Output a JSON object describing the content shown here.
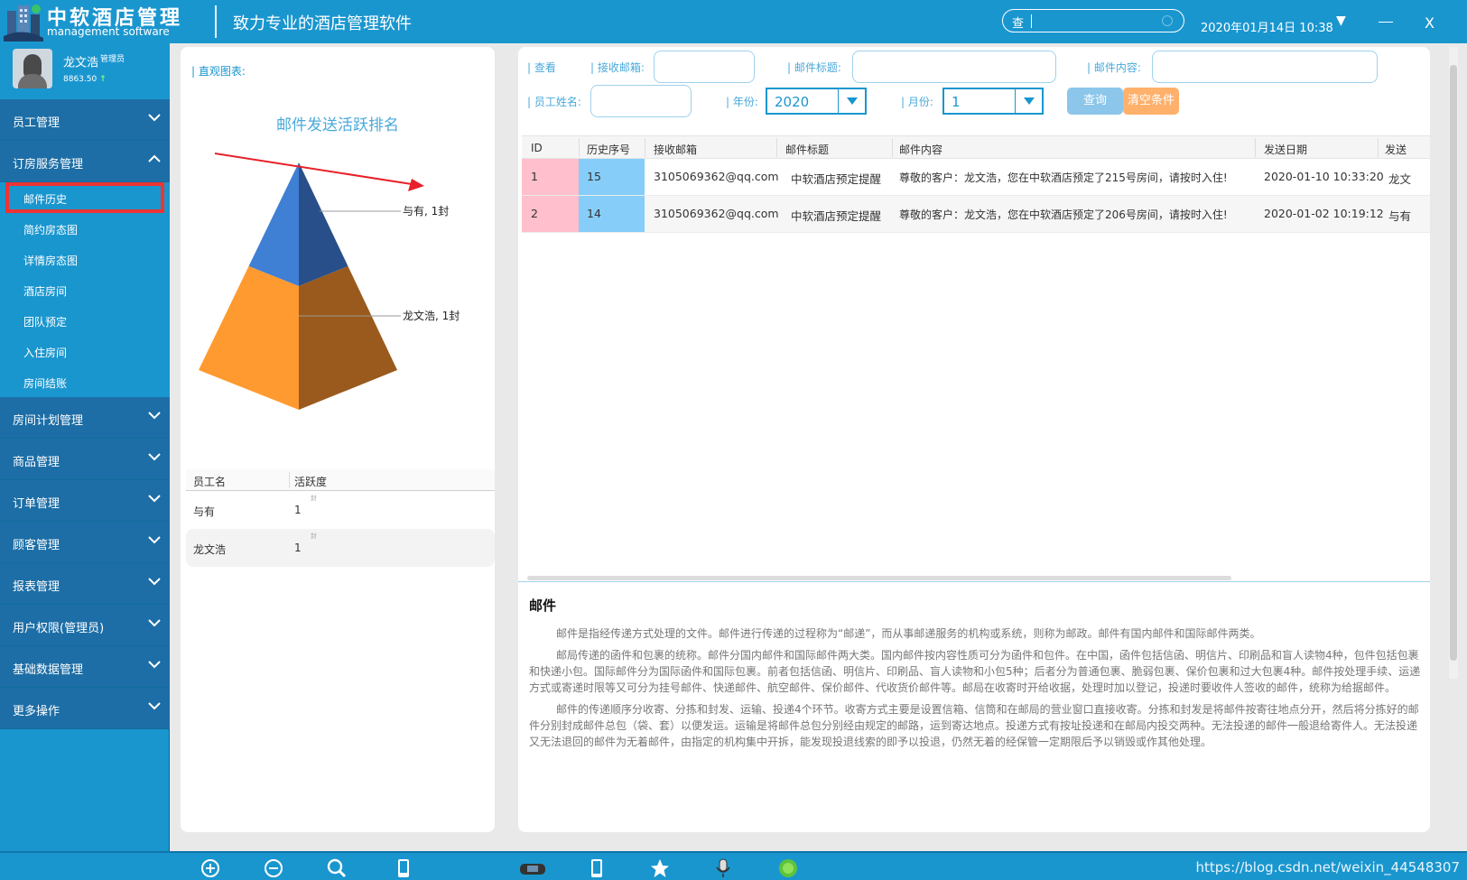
{
  "topbar": {
    "title": "中软酒店管理",
    "subtitle": "management software",
    "slogan": "致力专业的酒店管理软件",
    "search_label": "查",
    "datetime": "2020年01月14日 10:38",
    "dropdown_glyph": "▼",
    "close_label": "X"
  },
  "user": {
    "name": "龙文浩",
    "role": "管理员",
    "balance": "8863.50",
    "trend": "↑"
  },
  "menu": {
    "groups": [
      {
        "label": "员工管理"
      },
      {
        "label": "订房服务管理"
      },
      {
        "label": "房间计划管理"
      },
      {
        "label": "商品管理"
      },
      {
        "label": "订单管理"
      },
      {
        "label": "顾客管理"
      },
      {
        "label": "报表管理"
      },
      {
        "label": "用户权限(管理员)"
      },
      {
        "label": "基础数据管理"
      },
      {
        "label": "更多操作"
      }
    ],
    "sub_items": [
      "邮件历史",
      "简约房态图",
      "详情房态图",
      "酒店房间",
      "团队预定",
      "入住房间",
      "房间结账"
    ]
  },
  "chart_panel": {
    "tag": "| 直观图表:",
    "title": "邮件发送活跃排名"
  },
  "chart_data": {
    "type": "pyramid",
    "title": "邮件发送活跃排名",
    "categories": [
      "与有",
      "龙文浩"
    ],
    "values": [
      1,
      1
    ],
    "data_labels": [
      "与有, 1封",
      "龙文浩, 1封"
    ],
    "colors": {
      "top": "#3f7fd4",
      "top_dark": "#294f8a",
      "bottom": "#ff9a30",
      "bottom_dark": "#9a5a1d"
    }
  },
  "mini_table": {
    "headers": [
      "员工名",
      "活跃度"
    ],
    "unit": "封",
    "rows": [
      {
        "name": "与有",
        "value": "1"
      },
      {
        "name": "龙文浩",
        "value": "1"
      }
    ]
  },
  "filters": {
    "view_label": "| 查看",
    "recv_label": "| 接收邮箱:",
    "subject_label": "| 邮件标题:",
    "content_label": "| 邮件内容:",
    "employee_label": "| 员工姓名:",
    "year_label": "| 年份:",
    "year_value": "2020",
    "month_label": "| 月份:",
    "month_value": "1",
    "query_button": "查询",
    "clear_button": "清空条件"
  },
  "grid": {
    "headers": [
      "ID",
      "历史序号",
      "接收邮箱",
      "邮件标题",
      "邮件内容",
      "发送日期",
      "发送"
    ],
    "rows": [
      {
        "id": "1",
        "hist": "15",
        "email": "3105069362@qq.com",
        "subject": "中软酒店预定提醒",
        "content": "尊敬的客户：龙文浩，您在中软酒店预定了215号房间，请按时入住!",
        "date": "2020-01-10 10:33:20",
        "sender": "龙文"
      },
      {
        "id": "2",
        "hist": "14",
        "email": "3105069362@qq.com",
        "subject": "中软酒店预定提醒",
        "content": "尊敬的客户：龙文浩，您在中软酒店预定了206号房间，请按时入住!",
        "date": "2020-01-02 10:19:12",
        "sender": "与有"
      }
    ]
  },
  "doc": {
    "heading": "邮件",
    "paragraphs": [
      "邮件是指经传递方式处理的文件。邮件进行传递的过程称为“邮递”，而从事邮递服务的机构或系统，则称为邮政。邮件有国内邮件和国际邮件两类。",
      "邮局传递的函件和包裹的统称。邮件分国内邮件和国际邮件两大类。国内邮件按内容性质可分为函件和包件。在中国，函件包括信函、明信片、印刷品和盲人读物4种，包件包括包裹和快递小包。国际邮件分为国际函件和国际包裹。前者包括信函、明信片、印刷品、盲人读物和小包5种；后者分为普通包裹、脆弱包裹、保价包裹和过大包裹4种。邮件按处理手续、运递方式或寄递时限等又可分为挂号邮件、快递邮件、航空邮件、保价邮件、代收货价邮件等。邮局在收寄时开给收据，处理时加以登记，投递时要收件人签收的邮件，统称为给据邮件。",
      "邮件的传递顺序分收寄、分拣和封发、运输、投递4个环节。收寄方式主要是设置信箱、信筒和在邮局的营业窗口直接收寄。分拣和封发是将邮件按寄往地点分开，然后将分拣好的邮件分别封成邮件总包（袋、套）以便发运。运输是将邮件总包分别经由规定的邮路，运到寄达地点。投递方式有按址投递和在邮局内投交两种。无法投递的邮件一般退给寄件人。无法投递又无法退回的邮件为无着邮件，由指定的机构集中开拆，能发现投退线索的即予以投退，仍然无着的经保管一定期限后予以销毁或作其他处理。"
    ]
  },
  "bottombar": {
    "url": "https://blog.csdn.net/weixin_44548307",
    "icons": [
      "zoom-in-icon",
      "zoom-out-icon",
      "search-icon",
      "tablet-icon",
      "gamepad-icon",
      "phone-icon",
      "star-icon",
      "microphone-icon",
      "globe-icon"
    ]
  }
}
